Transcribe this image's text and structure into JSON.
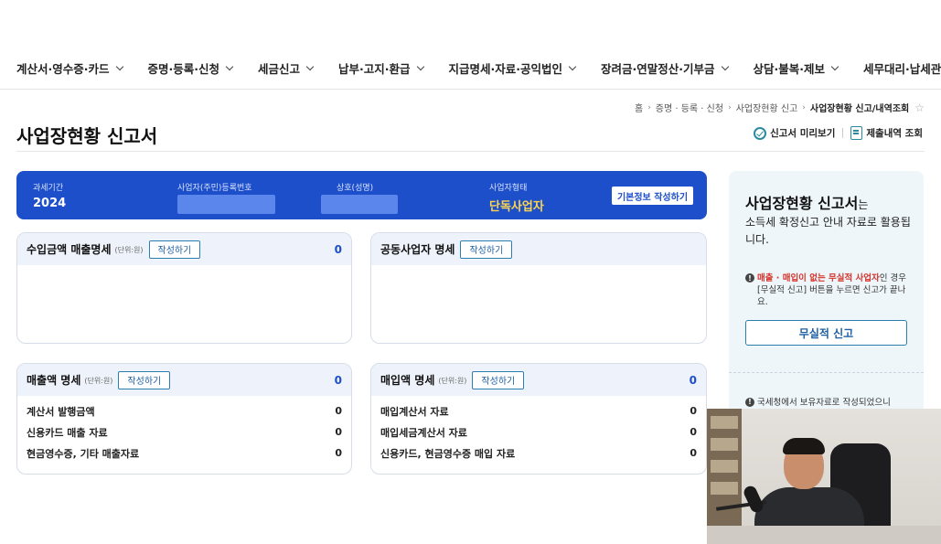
{
  "nav": {
    "items": [
      "계산서·영수증·카드",
      "증명·등록·신청",
      "세금신고",
      "납부·고지·환급",
      "지급명세·자료·공익법인",
      "장려금·연말정산·기부금",
      "상담·불복·제보",
      "세무대리·납세관리"
    ]
  },
  "breadcrumb": {
    "items": [
      "홈",
      "증명 · 등록 · 신청",
      "사업장현황 신고"
    ],
    "current": "사업장현황 신고/내역조회"
  },
  "page": {
    "title": "사업장현황 신고서",
    "preview_label": "신고서 미리보기",
    "history_label": "제출내역 조회"
  },
  "info": {
    "period_label": "과세기간",
    "period_value": "2024",
    "regno_label": "사업자(주민)등록번호",
    "name_label": "상호(성명)",
    "type_label": "사업자형태",
    "type_value": "단독사업자",
    "basic_button": "기본정보 작성하기"
  },
  "cards": {
    "income": {
      "title": "수입금액 매출명세",
      "unit": "(단위:원)",
      "write": "작성하기",
      "count": "0"
    },
    "partner": {
      "title": "공동사업자 명세",
      "write": "작성하기"
    },
    "sales": {
      "title": "매출액 명세",
      "unit": "(단위:원)",
      "write": "작성하기",
      "count": "0",
      "rows": [
        {
          "label": "계산서 발행금액",
          "value": "0"
        },
        {
          "label": "신용카드 매출 자료",
          "value": "0"
        },
        {
          "label": "현금영수증, 기타 매출자료",
          "value": "0"
        }
      ]
    },
    "purchase": {
      "title": "매입액 명세",
      "unit": "(단위:원)",
      "write": "작성하기",
      "count": "0",
      "rows": [
        {
          "label": "매입계산서 자료",
          "value": "0"
        },
        {
          "label": "매입세금계산서 자료",
          "value": "0"
        },
        {
          "label": "신용카드, 현금영수증 매입 자료",
          "value": "0"
        }
      ]
    }
  },
  "side": {
    "title": "사업장현황 신고서",
    "title_suffix": "는",
    "desc": "소득세 확정신고 안내 자료로 활용됩니다.",
    "notice_red": "매출 · 매입이 없는 무실적 사업자",
    "notice_rest": "인 경우 [무실적 신고] 버튼을 누르면 신고가 끝나요.",
    "nil_button": "무실적 신고",
    "notice2": "국세청에서 보유자료로 작성되었으니"
  },
  "colors": {
    "primary": "#1d4fcb",
    "accent_yellow": "#ffd54a",
    "notice_red": "#d6342c",
    "card_head": "#eef3fb"
  }
}
